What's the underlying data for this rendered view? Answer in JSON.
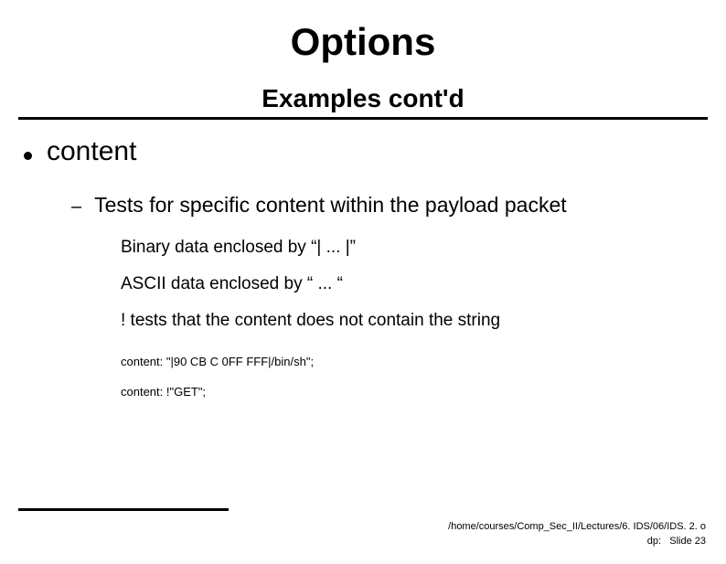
{
  "title": "Options",
  "subtitle": "Examples cont'd",
  "bullet": {
    "text": "content",
    "sub": {
      "text": "Tests for specific content within the payload packet",
      "items": [
        "Binary data enclosed by “| ... |”",
        "ASCII data enclosed by “ ... “",
        "! tests that the content does not contain the string"
      ],
      "examples": [
        "content: \"|90 CB C 0FF FFF|/bin/sh\";",
        "content: !\"GET\";"
      ]
    }
  },
  "footer": {
    "path": "/home/courses/Comp_Sec_II/Lectures/6. IDS/06/IDS. 2. o",
    "label": "dp:",
    "slide": "Slide 23"
  }
}
